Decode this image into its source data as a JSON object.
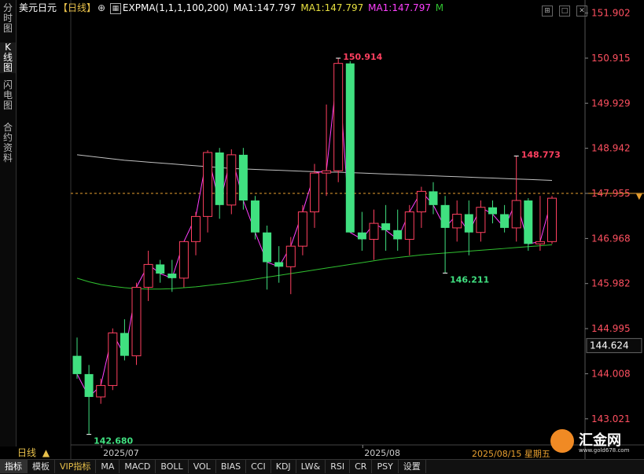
{
  "side_tabs": [
    {
      "label": "分时图",
      "active": false
    },
    {
      "label": "K线图",
      "active": true
    },
    {
      "label": "闪电图",
      "active": false
    },
    {
      "label": "合约资料",
      "active": false
    }
  ],
  "header": {
    "symbol": "美元日元",
    "period": "【日线】",
    "zoom_icon": "⊕",
    "indicator": "EXPMA(1,1,1,100,200)",
    "ma1_a": "MA1:147.797",
    "ma1_b": "MA1:147.797",
    "ma1_c": "MA1:147.797",
    "m_label": "M"
  },
  "colors": {
    "up": "#ff4060",
    "down": "#40e080",
    "ma_short": "#ff40ff",
    "ma_100": "#c0c0c0",
    "ma_200": "#30c030",
    "axis_text": "#ff5060",
    "dashed_line": "#e8a030",
    "price_yellow": "#e8e040"
  },
  "chart_data": {
    "type": "candlestick",
    "y_ticks": [
      "151.902",
      "150.915",
      "149.929",
      "148.942",
      "147.955",
      "146.968",
      "145.982",
      "144.995",
      "144.008",
      "143.021"
    ],
    "ylim": [
      142.45,
      152.05
    ],
    "x_labels": [
      {
        "label": "2025/07",
        "index": 1
      },
      {
        "label": "2025/08",
        "index": 23
      }
    ],
    "annotations": [
      {
        "label": "150.914",
        "index": 22,
        "value": 150.914,
        "kind": "high"
      },
      {
        "label": "148.773",
        "index": 37,
        "value": 148.773,
        "kind": "high"
      },
      {
        "label": "146.211",
        "index": 31,
        "value": 146.211,
        "kind": "low"
      },
      {
        "label": "142.680",
        "index": 1,
        "value": 142.68,
        "kind": "low"
      }
    ],
    "current_price": 147.955,
    "highlight_price": "144.624",
    "candles": [
      {
        "o": 144.4,
        "h": 144.8,
        "l": 143.9,
        "c": 144.0
      },
      {
        "o": 144.0,
        "h": 144.2,
        "l": 142.68,
        "c": 143.5
      },
      {
        "o": 143.5,
        "h": 143.9,
        "l": 143.35,
        "c": 143.75
      },
      {
        "o": 143.75,
        "h": 145.0,
        "l": 143.65,
        "c": 144.9
      },
      {
        "o": 144.9,
        "h": 145.2,
        "l": 144.3,
        "c": 144.4
      },
      {
        "o": 144.4,
        "h": 146.0,
        "l": 144.2,
        "c": 145.9
      },
      {
        "o": 145.9,
        "h": 146.7,
        "l": 145.6,
        "c": 146.4
      },
      {
        "o": 146.4,
        "h": 146.5,
        "l": 146.0,
        "c": 146.2
      },
      {
        "o": 146.2,
        "h": 146.5,
        "l": 145.8,
        "c": 146.1
      },
      {
        "o": 146.1,
        "h": 146.8,
        "l": 145.9,
        "c": 146.9
      },
      {
        "o": 146.9,
        "h": 147.55,
        "l": 146.6,
        "c": 147.45
      },
      {
        "o": 147.45,
        "h": 148.9,
        "l": 147.1,
        "c": 148.85
      },
      {
        "o": 148.85,
        "h": 148.95,
        "l": 147.4,
        "c": 147.7
      },
      {
        "o": 147.7,
        "h": 148.92,
        "l": 147.5,
        "c": 148.8
      },
      {
        "o": 148.8,
        "h": 148.95,
        "l": 147.6,
        "c": 147.8
      },
      {
        "o": 147.8,
        "h": 147.9,
        "l": 146.95,
        "c": 147.1
      },
      {
        "o": 147.1,
        "h": 147.25,
        "l": 145.85,
        "c": 146.45
      },
      {
        "o": 146.45,
        "h": 146.8,
        "l": 146.0,
        "c": 146.35
      },
      {
        "o": 146.35,
        "h": 147.0,
        "l": 145.75,
        "c": 146.8
      },
      {
        "o": 146.8,
        "h": 147.7,
        "l": 146.6,
        "c": 147.55
      },
      {
        "o": 147.55,
        "h": 148.6,
        "l": 147.2,
        "c": 148.4
      },
      {
        "o": 148.4,
        "h": 149.9,
        "l": 147.9,
        "c": 148.45
      },
      {
        "o": 148.45,
        "h": 150.914,
        "l": 148.2,
        "c": 150.8
      },
      {
        "o": 150.8,
        "h": 150.85,
        "l": 147.1,
        "c": 147.1
      },
      {
        "o": 147.1,
        "h": 147.55,
        "l": 146.7,
        "c": 146.95
      },
      {
        "o": 146.95,
        "h": 147.6,
        "l": 146.5,
        "c": 147.3
      },
      {
        "o": 147.3,
        "h": 147.7,
        "l": 146.7,
        "c": 147.15
      },
      {
        "o": 147.15,
        "h": 147.6,
        "l": 146.7,
        "c": 146.95
      },
      {
        "o": 146.95,
        "h": 147.7,
        "l": 146.6,
        "c": 147.55
      },
      {
        "o": 147.55,
        "h": 148.1,
        "l": 147.2,
        "c": 148.0
      },
      {
        "o": 148.0,
        "h": 148.2,
        "l": 147.5,
        "c": 147.7
      },
      {
        "o": 147.7,
        "h": 147.9,
        "l": 146.211,
        "c": 147.2
      },
      {
        "o": 147.2,
        "h": 147.8,
        "l": 146.9,
        "c": 147.5
      },
      {
        "o": 147.5,
        "h": 147.8,
        "l": 146.6,
        "c": 147.1
      },
      {
        "o": 147.1,
        "h": 147.8,
        "l": 146.9,
        "c": 147.65
      },
      {
        "o": 147.65,
        "h": 147.8,
        "l": 147.3,
        "c": 147.5
      },
      {
        "o": 147.5,
        "h": 147.7,
        "l": 147.1,
        "c": 147.2
      },
      {
        "o": 147.2,
        "h": 148.773,
        "l": 146.9,
        "c": 147.8
      },
      {
        "o": 147.8,
        "h": 147.85,
        "l": 146.7,
        "c": 146.85
      },
      {
        "o": 146.85,
        "h": 147.9,
        "l": 146.7,
        "c": 146.9
      },
      {
        "o": 146.9,
        "h": 147.9,
        "l": 146.85,
        "c": 147.85
      }
    ],
    "ma_short": [
      144.0,
      143.5,
      143.75,
      144.9,
      144.4,
      145.9,
      146.4,
      146.2,
      146.1,
      146.9,
      147.45,
      148.85,
      147.7,
      148.8,
      147.8,
      147.1,
      146.45,
      146.35,
      146.8,
      147.55,
      148.4,
      148.45,
      150.8,
      147.1,
      146.95,
      147.3,
      147.15,
      146.95,
      147.55,
      148.0,
      147.7,
      147.2,
      147.5,
      147.1,
      147.65,
      147.5,
      147.2,
      147.8,
      146.85,
      146.9,
      147.85
    ],
    "ma_100": [
      148.8,
      148.77,
      148.74,
      148.71,
      148.68,
      148.66,
      148.64,
      148.62,
      148.6,
      148.58,
      148.56,
      148.54,
      148.52,
      148.5,
      148.49,
      148.48,
      148.47,
      148.46,
      148.45,
      148.44,
      148.43,
      148.42,
      148.42,
      148.41,
      148.4,
      148.39,
      148.38,
      148.37,
      148.36,
      148.35,
      148.34,
      148.33,
      148.32,
      148.31,
      148.3,
      148.29,
      148.28,
      148.27,
      148.26,
      148.25,
      148.24
    ],
    "ma_200": [
      146.1,
      146.02,
      145.96,
      145.92,
      145.89,
      145.87,
      145.86,
      145.86,
      145.87,
      145.89,
      145.91,
      145.94,
      145.97,
      146.0,
      146.04,
      146.08,
      146.12,
      146.16,
      146.2,
      146.24,
      146.28,
      146.32,
      146.36,
      146.4,
      146.44,
      146.48,
      146.52,
      146.55,
      146.58,
      146.61,
      146.63,
      146.65,
      146.67,
      146.69,
      146.71,
      146.73,
      146.75,
      146.77,
      146.79,
      146.81,
      146.83
    ]
  },
  "period_bar": {
    "label": "日线",
    "arrow": "▲"
  },
  "current_date": "2025/08/15 星期五",
  "bottom_tabs": [
    {
      "label": "指标",
      "active": true,
      "vip": false
    },
    {
      "label": "模板",
      "active": false,
      "vip": false
    },
    {
      "label": "VIP指标",
      "active": false,
      "vip": true
    },
    {
      "label": "MA",
      "active": false,
      "vip": false
    },
    {
      "label": "MACD",
      "active": false,
      "vip": false
    },
    {
      "label": "BOLL",
      "active": false,
      "vip": false
    },
    {
      "label": "VOL",
      "active": false,
      "vip": false
    },
    {
      "label": "BIAS",
      "active": false,
      "vip": false
    },
    {
      "label": "CCI",
      "active": false,
      "vip": false
    },
    {
      "label": "KDJ",
      "active": false,
      "vip": false
    },
    {
      "label": "LW&",
      "active": false,
      "vip": false
    },
    {
      "label": "RSI",
      "active": false,
      "vip": false
    },
    {
      "label": "CR",
      "active": false,
      "vip": false
    },
    {
      "label": "PSY",
      "active": false,
      "vip": false
    },
    {
      "label": "设置",
      "active": false,
      "vip": false
    }
  ],
  "logo": {
    "name": "汇金网",
    "url_text": "www.gold678.com"
  },
  "window_buttons": [
    {
      "icon": "grid-icon",
      "glyph": "⊞"
    },
    {
      "icon": "square-icon",
      "glyph": "□"
    },
    {
      "icon": "close-icon",
      "glyph": "✕"
    }
  ]
}
